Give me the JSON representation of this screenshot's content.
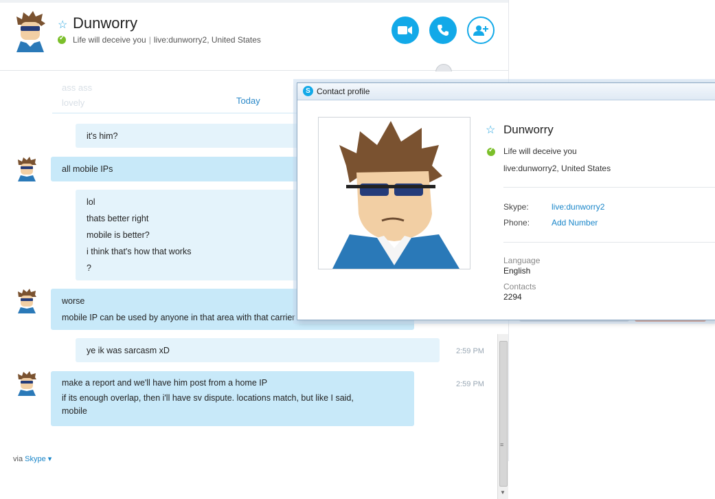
{
  "header": {
    "name": "Dunworry",
    "mood": "Life will deceive you",
    "separator": "|",
    "location": "live:dunworry2, United States",
    "buttons": {
      "video": "video-call",
      "call": "voice-call",
      "add": "add-contact"
    }
  },
  "chat": {
    "faded_top": [
      "ass ass",
      "lovely"
    ],
    "date_divider": "Today",
    "messages": [
      {
        "who": "me",
        "lines": [
          "it's him?"
        ],
        "time": ""
      },
      {
        "who": "them",
        "lines": [
          "all mobile IPs"
        ],
        "time": ""
      },
      {
        "who": "me",
        "lines": [
          "lol",
          "thats better right",
          "mobile is better?",
          "i think that's how that works",
          "?"
        ],
        "time": ""
      },
      {
        "who": "them",
        "lines": [
          "worse",
          "mobile IP can be used by anyone in that area with that carrier"
        ],
        "time": ""
      },
      {
        "who": "me",
        "lines": [
          "ye ik was sarcasm xD"
        ],
        "time": "2:59 PM"
      },
      {
        "who": "them",
        "lines": [
          "make a report and we'll have him post from a home IP",
          "if its enough overlap, then i'll have sv dispute. locations match, but like I said,",
          "mobile"
        ],
        "time": "2:59 PM"
      }
    ],
    "via_prefix": "via",
    "via_brand": "Skype"
  },
  "profile": {
    "window_title": "Contact profile",
    "name": "Dunworry",
    "mood": "Life will deceive you",
    "location": "live:dunworry2, United States",
    "skype_label": "Skype:",
    "skype_value": "live:dunworry2",
    "phone_label": "Phone:",
    "phone_value": "Add Number",
    "language_label": "Language",
    "language_value": "English",
    "contacts_label": "Contacts",
    "contacts_value": "2294"
  },
  "colors": {
    "accent": "#12a9e8",
    "online": "#7bbf2a",
    "bubble_mine": "#e4f3fb",
    "bubble_theirs": "#c8e9f9"
  }
}
